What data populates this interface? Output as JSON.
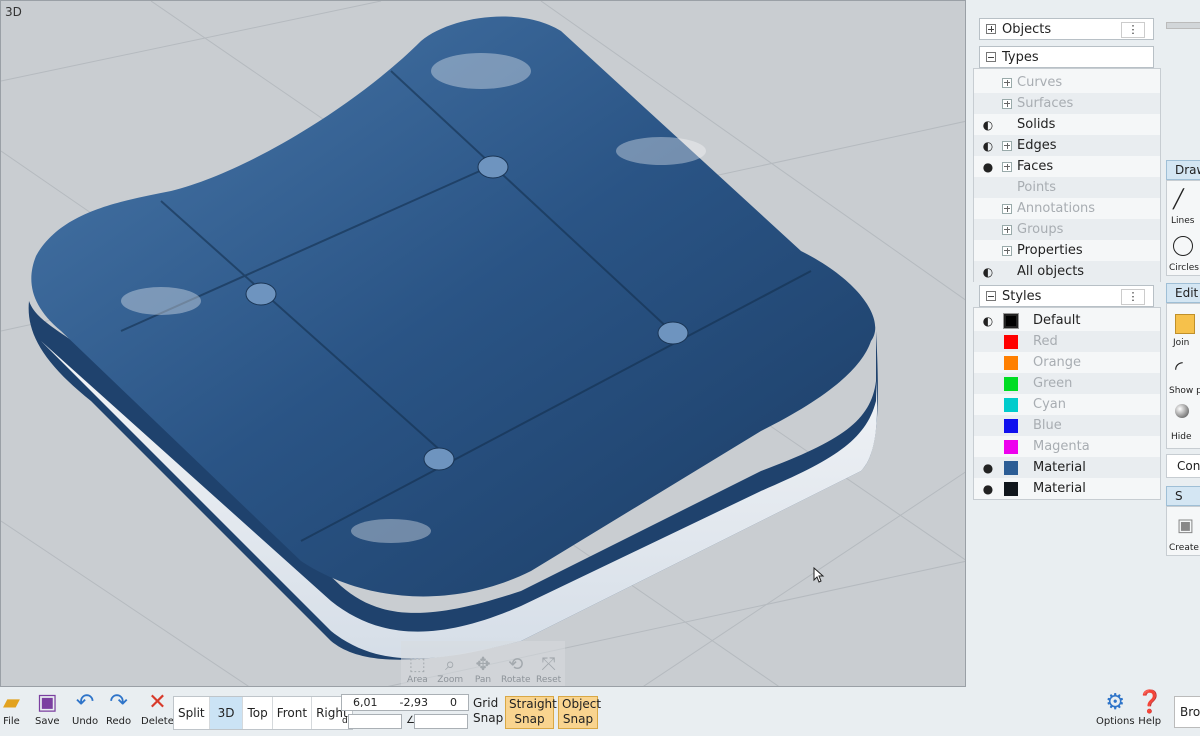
{
  "viewport": {
    "label": "3D",
    "nav": [
      {
        "label": "Area",
        "icon": "area-zoom-icon"
      },
      {
        "label": "Zoom",
        "icon": "zoom-icon"
      },
      {
        "label": "Pan",
        "icon": "pan-icon"
      },
      {
        "label": "Rotate",
        "icon": "rotate-icon"
      },
      {
        "label": "Reset",
        "icon": "reset-view-icon"
      }
    ]
  },
  "objects_panel": {
    "title": "Objects",
    "menu": "⋮"
  },
  "types_panel": {
    "title": "Types",
    "items": [
      {
        "label": "Curves",
        "expandable": true,
        "dim": true,
        "eye": ""
      },
      {
        "label": "Surfaces",
        "expandable": true,
        "dim": true,
        "eye": ""
      },
      {
        "label": "Solids",
        "expandable": false,
        "dim": false,
        "eye": "◐"
      },
      {
        "label": "Edges",
        "expandable": true,
        "dim": false,
        "eye": "◐"
      },
      {
        "label": "Faces",
        "expandable": true,
        "dim": false,
        "eye": "●"
      },
      {
        "label": "Points",
        "expandable": false,
        "dim": true,
        "eye": ""
      },
      {
        "label": "Annotations",
        "expandable": true,
        "dim": true,
        "eye": ""
      },
      {
        "label": "Groups",
        "expandable": true,
        "dim": true,
        "eye": ""
      },
      {
        "label": "Properties",
        "expandable": true,
        "dim": false,
        "eye": ""
      },
      {
        "label": "All objects",
        "expandable": false,
        "dim": false,
        "eye": "◐"
      }
    ]
  },
  "styles_panel": {
    "title": "Styles",
    "menu": "⋮",
    "items": [
      {
        "label": "Default",
        "color": "#000000",
        "dim": false,
        "eye": "◐",
        "selected": true
      },
      {
        "label": "Red",
        "color": "#ff0000",
        "dim": true,
        "eye": "",
        "selected": false
      },
      {
        "label": "Orange",
        "color": "#ff7f00",
        "dim": true,
        "eye": "",
        "selected": false
      },
      {
        "label": "Green",
        "color": "#00dd22",
        "dim": true,
        "eye": "",
        "selected": false
      },
      {
        "label": "Cyan",
        "color": "#00cccc",
        "dim": true,
        "eye": "",
        "selected": false
      },
      {
        "label": "Blue",
        "color": "#1010ee",
        "dim": true,
        "eye": "",
        "selected": false
      },
      {
        "label": "Magenta",
        "color": "#ee00ee",
        "dim": true,
        "eye": "",
        "selected": false
      },
      {
        "label": "Material",
        "color": "#2c5d95",
        "dim": false,
        "eye": "●",
        "selected": false
      },
      {
        "label": "Material",
        "color": "#10161c",
        "dim": false,
        "eye": "●",
        "selected": false
      }
    ]
  },
  "right_strip": {
    "draw_tab": "Draw",
    "lines": "Lines",
    "circles": "Circles",
    "edit_tab": "Edit",
    "join": "Join",
    "show": "Show p",
    "hide": "Hide",
    "con": "Con",
    "s_tab": "S",
    "create": "Create",
    "bro": "Bro"
  },
  "toolbar": {
    "file": "File",
    "save": "Save",
    "undo": "Undo",
    "redo": "Redo",
    "delete": "Delete",
    "views": [
      "Split",
      "3D",
      "Top",
      "Front",
      "Right"
    ],
    "active_view": "3D",
    "coords": [
      "6,01",
      "-2,93",
      "0"
    ],
    "d_label": "d",
    "angle_label": "∠",
    "grid_snap": [
      "Grid",
      "Snap"
    ],
    "straight_snap": [
      "Straight",
      "Snap"
    ],
    "object_snap": [
      "Object",
      "Snap"
    ],
    "options": "Options",
    "help": "Help"
  }
}
